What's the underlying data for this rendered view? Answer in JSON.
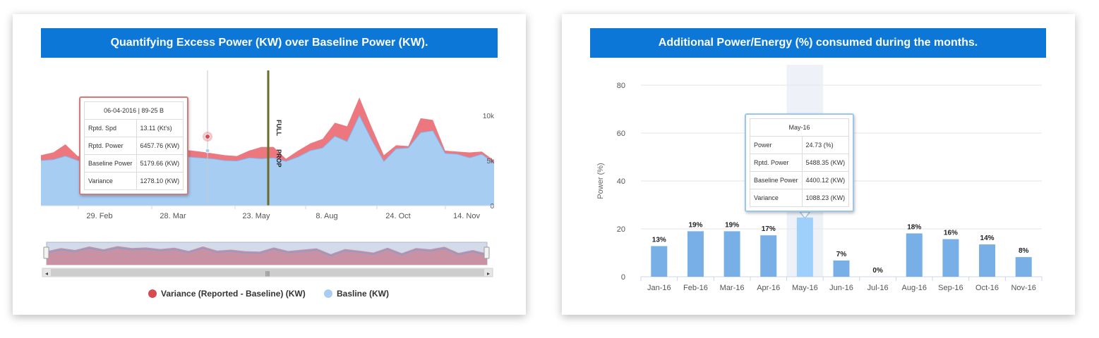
{
  "chart_data": [
    {
      "type": "area",
      "title": "Quantifying Excess Power (KW) over Baseline Power (KW).",
      "x_ticks": [
        "29. Feb",
        "28. Mar",
        "23. May",
        "8. Aug",
        "24. Oct",
        "14. Nov"
      ],
      "y_ticks": [
        "10k",
        "5k",
        "0"
      ],
      "ylim": [
        0,
        15000
      ],
      "series": [
        {
          "name": "Variance (Reported - Baseline) (KW)",
          "color": "#ec6b74"
        },
        {
          "name": "Basline (KW)",
          "color": "#a8cdf3"
        }
      ],
      "reported": [
        5600,
        5900,
        6800,
        5500,
        5400,
        5500,
        6200,
        6300,
        6500,
        6700,
        6450,
        6300,
        6150,
        6000,
        5800,
        5600,
        5500,
        6100,
        6500,
        6500,
        5200,
        6100,
        6900,
        7400,
        9200,
        8800,
        12000,
        8700,
        5600,
        6700,
        6600,
        9700,
        9500,
        6100,
        6000,
        5900,
        6000,
        5000
      ],
      "baseline": [
        5000,
        5100,
        5500,
        5000,
        4900,
        5000,
        5600,
        5700,
        5800,
        5600,
        5300,
        5500,
        5400,
        5300,
        5200,
        5000,
        4950,
        5300,
        5200,
        5300,
        4900,
        5400,
        6100,
        6400,
        7700,
        7100,
        10000,
        7300,
        4900,
        6300,
        6400,
        8100,
        8300,
        5800,
        5700,
        5300,
        5700,
        4700
      ],
      "navigator_reported": [
        4200,
        5200,
        4600,
        5700,
        4800,
        5800,
        5200,
        5400,
        4900,
        5300,
        4300,
        5700,
        4400,
        4700,
        4200,
        4100,
        5400,
        4300,
        4700,
        5100,
        3300,
        4900,
        4400,
        3800,
        5300,
        3600,
        5200,
        4800,
        5600,
        3700,
        4600,
        3500
      ],
      "navigator_baseline": [
        3700,
        4700,
        4100,
        5200,
        4300,
        5300,
        4700,
        4900,
        4400,
        4800,
        3800,
        5200,
        3900,
        4200,
        3700,
        3600,
        4900,
        3800,
        4200,
        4600,
        2800,
        4400,
        3900,
        3300,
        4800,
        3100,
        4700,
        4300,
        5100,
        3200,
        4100,
        3000
      ],
      "plot_bands": [
        "FULL",
        "PROP"
      ],
      "tooltip": {
        "header": "06-04-2016 | 89-25 B",
        "rows": [
          {
            "label": "Rptd. Spd",
            "value": "13.11 (Kt's)"
          },
          {
            "label": "Rptd. Power",
            "value": "6457.76 (KW)"
          },
          {
            "label": "Baseline Power",
            "value": "5179.66 (KW)"
          },
          {
            "label": "Variance",
            "value": "1278.10 (KW)"
          }
        ]
      }
    },
    {
      "type": "bar",
      "title": "Additional Power/Energy (%) consumed during the months.",
      "ylabel": "Power (%)",
      "ylim": [
        0,
        80
      ],
      "y_ticks": [
        0,
        20,
        40,
        60,
        80
      ],
      "categories": [
        "Jan-16",
        "Feb-16",
        "Mar-16",
        "Apr-16",
        "May-16",
        "Jun-16",
        "Jul-16",
        "Aug-16",
        "Sep-16",
        "Oct-16",
        "Nov-16"
      ],
      "values": [
        12.8,
        19,
        19,
        17.3,
        24.73,
        6.8,
        0,
        18.1,
        15.7,
        13.5,
        8.2
      ],
      "value_labels": [
        "13%",
        "19%",
        "19%",
        "17%",
        "",
        "7%",
        "0%",
        "18%",
        "16%",
        "14%",
        "8%"
      ],
      "highlight_index": 4,
      "bar_color": "#78afe6",
      "highlight_color": "#9fd0fb",
      "tooltip": {
        "header": "May-16",
        "rows": [
          {
            "label": "Power",
            "value": "24.73 (%)"
          },
          {
            "label": "Rptd. Power",
            "value": "5488.35 (KW)"
          },
          {
            "label": "Baseline Power",
            "value": "4400.12 (KW)"
          },
          {
            "label": "Variance",
            "value": "1088.23 (KW)"
          }
        ]
      }
    }
  ]
}
